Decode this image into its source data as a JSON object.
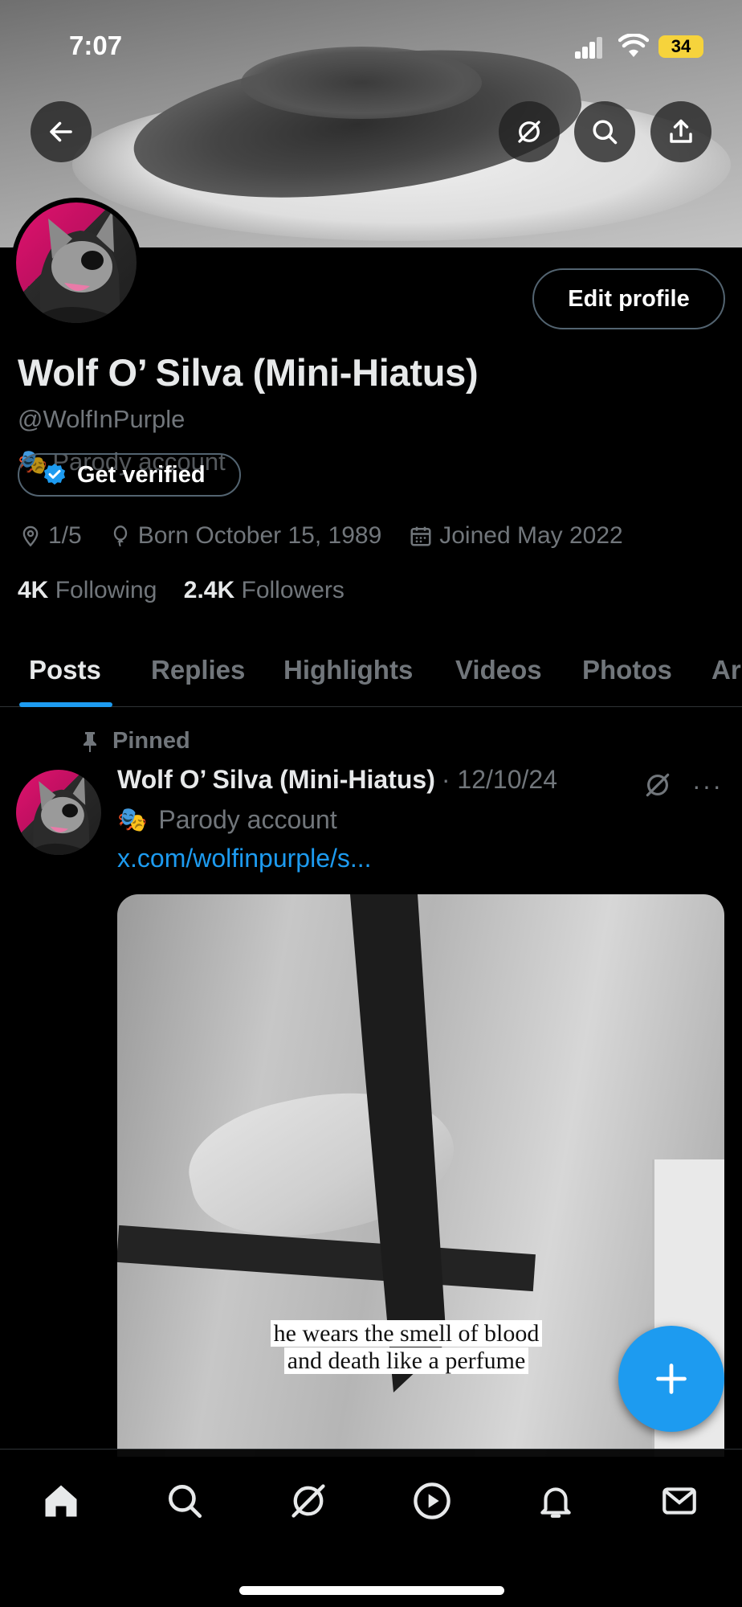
{
  "status_bar": {
    "time": "7:07",
    "battery": "34"
  },
  "profile": {
    "name": "Wolf O’ Silva (Mini-Hiatus)",
    "handle": "@WolfInPurple",
    "parody_label": "Parody account",
    "edit_button": "Edit profile",
    "get_verified": "Get verified",
    "location": "1/5",
    "birthday": "Born October 15, 1989",
    "joined": "Joined May 2022",
    "following_count": "4K",
    "following_label": "Following",
    "followers_count": "2.4K",
    "followers_label": "Followers"
  },
  "tabs": [
    {
      "label": "Posts"
    },
    {
      "label": "Replies"
    },
    {
      "label": "Highlights"
    },
    {
      "label": "Videos"
    },
    {
      "label": "Photos"
    },
    {
      "label": "Ar"
    }
  ],
  "pinned_post": {
    "pinned_label": "Pinned",
    "author": "Wolf O’ Silva (Mini-Hiatus)",
    "date": "· 12/10/24",
    "parody_label": "Parody account",
    "link": "x.com/wolfinpurple/s...",
    "caption_line1": "he wears the smell of blood",
    "caption_line2": "and death like a perfume",
    "more": "···"
  },
  "colors": {
    "accent": "#1d9bf0",
    "muted": "#71767b",
    "text": "#e7e9ea",
    "battery": "#f6d33c"
  },
  "icons": {
    "back": "arrow-left-icon",
    "grok": "grok-icon",
    "search": "search-icon",
    "share": "share-icon",
    "nav": [
      "home-icon",
      "search-icon",
      "grok-icon",
      "play-icon",
      "bell-icon",
      "mail-icon"
    ],
    "fab": "plus-icon"
  }
}
